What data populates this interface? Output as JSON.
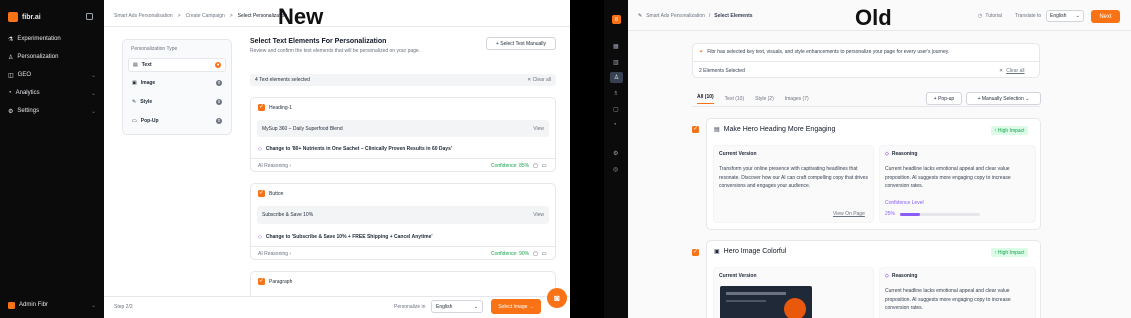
{
  "overlay_labels": {
    "left": "New",
    "right": "Old"
  },
  "colors": {
    "accent": "#f97316",
    "sidebar_bg": "#0b0b0b",
    "success": "#16a34a"
  },
  "left": {
    "brand": "fibr.ai",
    "nav": [
      {
        "icon": "flask-icon",
        "label": "Experimentation",
        "chevron": ""
      },
      {
        "icon": "person-icon",
        "label": "Personalization",
        "chevron": ""
      },
      {
        "icon": "globe-icon",
        "label": "GEO",
        "chevron": "⌄"
      },
      {
        "icon": "chart-icon",
        "label": "Analytics",
        "chevron": "⌄"
      },
      {
        "icon": "gear-icon",
        "label": "Settings",
        "chevron": "⌄"
      }
    ],
    "user": "Admin Fibr",
    "breadcrumb": [
      "Smart Ads Personalisation",
      ">",
      "Create Campaign",
      ">",
      "Select Personalization"
    ],
    "type_panel": {
      "title": "Personalization Type",
      "items": [
        {
          "icon": "text-icon",
          "label": "Text",
          "count": "●"
        },
        {
          "icon": "image-icon",
          "label": "Image",
          "count": "0"
        },
        {
          "icon": "style-icon",
          "label": "Style",
          "count": "0"
        },
        {
          "icon": "popup-icon",
          "label": "Pop-Up",
          "count": "0"
        }
      ]
    },
    "main": {
      "title": "Select Text Elements For Personalization",
      "subtitle": "Review and confirm the text elements that will be personalized on your page.",
      "manual_btn": "+  Select Text Manually",
      "selected": "4 Text elements selected",
      "clear": "✕ Clear all",
      "cards": [
        {
          "label": "Heading-1",
          "current": "MySup 360 – Daily Superfood Blend",
          "view": "View",
          "change": "Change to '80+ Nutrients in One Sachet – Clinically Proven Results in 60 Days'",
          "ai": "AI Reasoning  ›",
          "confidence": "Confidence: 85%"
        },
        {
          "label": "Button",
          "current": "Subscribe & Save 10%",
          "view": "View",
          "change": "Change to 'Subscribe & Save 10% + FREE Shipping + Cancel Anytime'",
          "ai": "AI Reasoning  ›",
          "confidence": "Confidence: 90%"
        },
        {
          "label": "Paragraph"
        }
      ]
    },
    "footer": {
      "step": "Step 2/2",
      "personalize_in": "Personalize in",
      "language": "English",
      "next": "Select Image  →"
    }
  },
  "right": {
    "breadcrumb": [
      "Smart Ads Personalization",
      "/",
      "Select Elements"
    ],
    "tutorial": "Tutorial",
    "translate": "Translate to",
    "language": "English",
    "next": "Next",
    "banner": "Fibr has selected key text, visuals, and style enhancements to personalize your page for every user's journey.",
    "selected": "2 Elements Selected",
    "clear": "Clear all",
    "tabs": [
      "All (10)",
      "Text (10)",
      "Style (2)",
      "Images (7)"
    ],
    "popup_btn": "+ Pop-up",
    "manual_btn": "+ Manually Selection  ⌄",
    "cards": [
      {
        "title": "Make Hero Heading More Engaging",
        "impact": "↑ High Impact",
        "current_title": "Current Version",
        "current": "Transform your online presence with captivating headlines that resonate. Discover how our AI can craft compelling copy that drives conversions and engages your audience.",
        "view": "View On Page",
        "reason_title": "Reasoning",
        "reason": "Current headline lacks emotional appeal and clear value proposition. AI suggests more engaging copy to increase conversion rates.",
        "confidence_label": "Confidence Level",
        "confidence": "25%",
        "confidence_value": 0.25
      },
      {
        "title": "Hero Image Colorful",
        "impact": "↑ High Impact",
        "current_title": "Current Version",
        "reason_title": "Reasoning",
        "reason": "Current headline lacks emotional appeal and clear value proposition. AI suggests more engaging copy to increase conversion rates."
      }
    ]
  }
}
